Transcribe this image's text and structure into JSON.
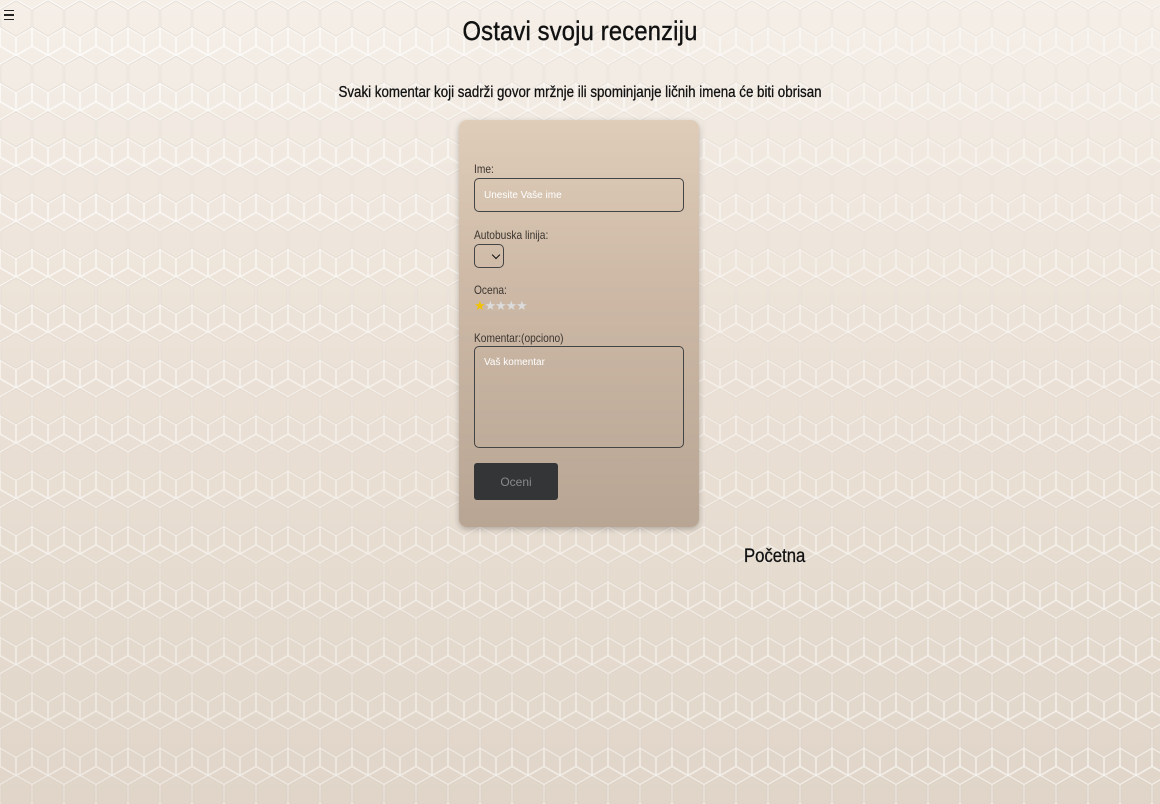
{
  "page": {
    "title": "Ostavi svoju recenziju",
    "notice": "Svaki komentar koji sadrži govor mržnje ili spominjanje ličnih imena će biti obrisan"
  },
  "menu": {
    "icon": "hamburger-menu-icon"
  },
  "form": {
    "name_label": "Ime:",
    "name_placeholder": "Unesite Vaše ime",
    "name_value": "",
    "line_label": "Autobuska linija:",
    "line_selected": "",
    "rating_label": "Ocena:",
    "rating_value": 1,
    "rating_max": 5,
    "rating_star_icon": "star-icon",
    "comment_label": "Komentar:(opciono)",
    "comment_placeholder": "Vaš komentar",
    "comment_value": "",
    "submit_label": "Oceni"
  },
  "nav": {
    "home_label": "Početna"
  },
  "colors": {
    "star_active": "#f2c200",
    "star_inactive": "#dcdcdc",
    "button_bg": "#333536",
    "card_top": "#dfcdb9",
    "card_bottom": "#b8a593"
  }
}
